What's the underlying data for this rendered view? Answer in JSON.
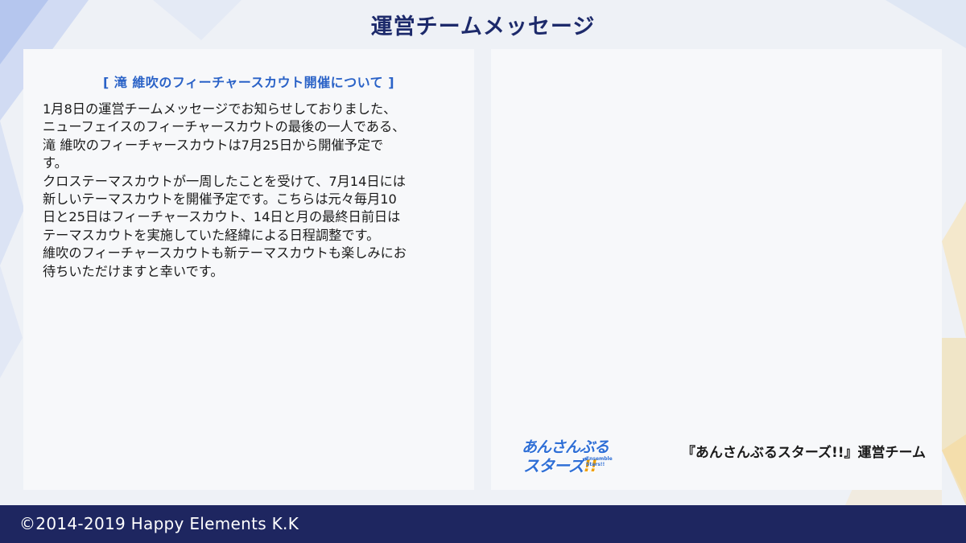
{
  "header": {
    "title": "運営チームメッセージ"
  },
  "notice": {
    "heading": "[ 滝 維吹のフィーチャースカウト開催について ]",
    "lines": [
      "1月8日の運営チームメッセージでお知らせしておりました、",
      "ニューフェイスのフィーチャースカウトの最後の一人である、",
      "滝 維吹のフィーチャースカウトは7月25日から開催予定で",
      "す。",
      "クロステーマスカウトが一周したことを受けて、7月14日には",
      "新しいテーマスカウトを開催予定です。こちらは元々毎月10",
      "日と25日はフィーチャースカウト、14日と月の最終日前日は",
      "テーマスカウトを実施していた経緯による日程調整です。",
      "維吹のフィーチャースカウトも新テーマスカウトも楽しみにお",
      "待ちいただけますと幸いです。"
    ]
  },
  "logo": {
    "line1": "あんさんぶる",
    "line2_text": "スターズ",
    "line2_mark": "!!",
    "subtitle": "Ensemble Stars!!"
  },
  "signature": "『あんさんぶるスターズ!!』運営チーム",
  "footer": {
    "copyright": "©2014-2019 Happy Elements K.K"
  },
  "colors": {
    "title": "#1d2a6b",
    "heading_accent": "#2a62c7",
    "footer_bg": "#1e2660",
    "logo_blue": "#2f6fd6",
    "logo_accent": "#f0a000"
  }
}
